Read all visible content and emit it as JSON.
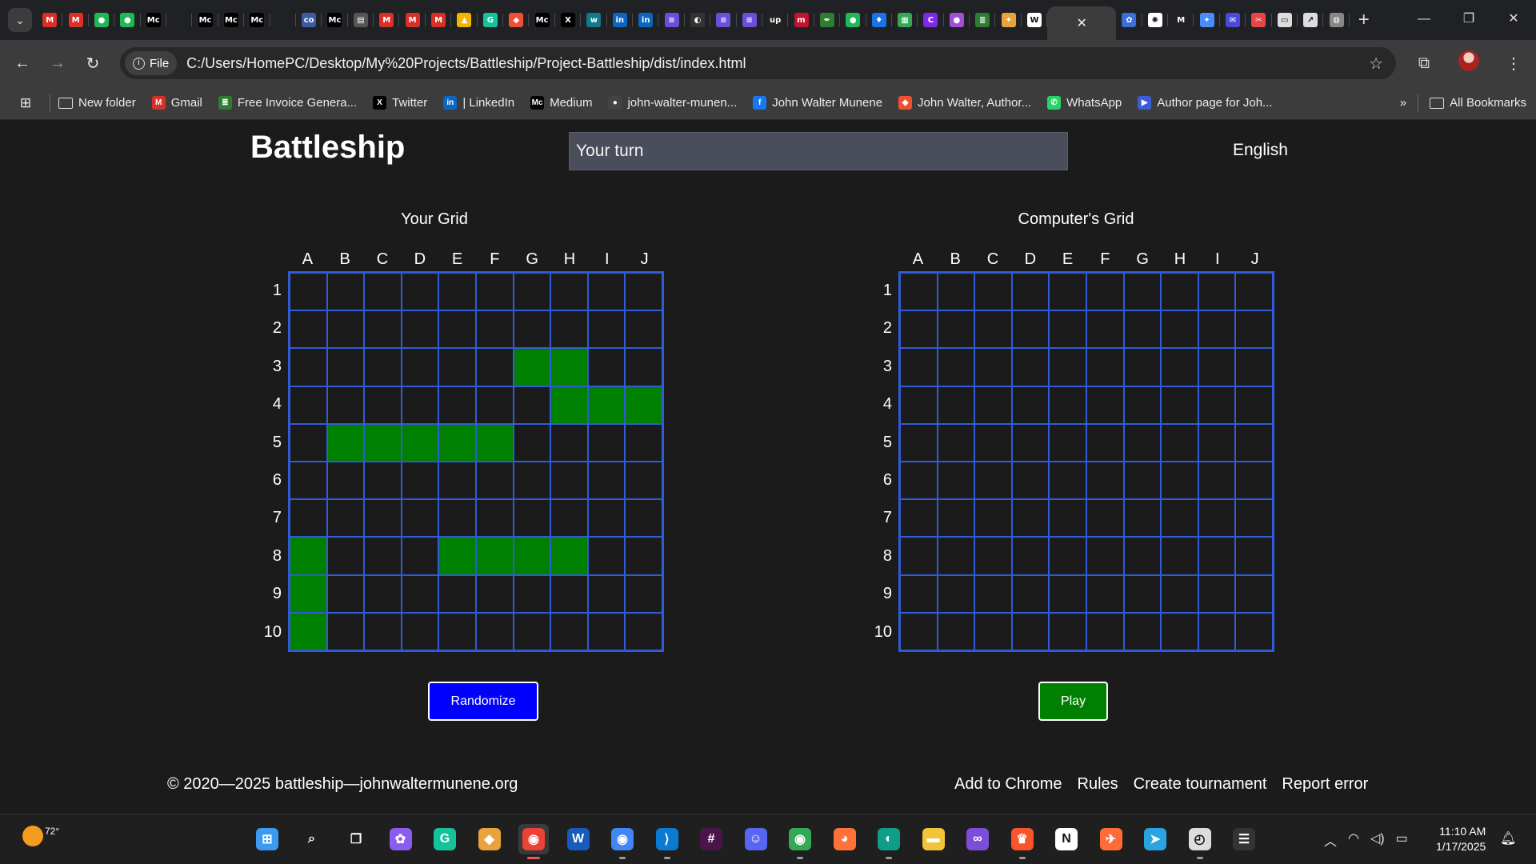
{
  "browser": {
    "tab_favicons": [
      {
        "icon": "gmail-icon",
        "glyph": "M",
        "color": "#d93025"
      },
      {
        "icon": "gmail-icon",
        "glyph": "M",
        "color": "#d93025"
      },
      {
        "icon": "green-dot-icon",
        "glyph": "●",
        "color": "#1db954"
      },
      {
        "icon": "green-dot-icon",
        "glyph": "●",
        "color": "#1db954"
      },
      {
        "icon": "medium-icon",
        "glyph": "Mc",
        "color": "#000000"
      },
      {
        "icon": "blank-icon",
        "glyph": "",
        "color": "#202124"
      },
      {
        "icon": "medium-icon",
        "glyph": "Mc",
        "color": "#000000"
      },
      {
        "icon": "medium-icon",
        "glyph": "Mc",
        "color": "#000000"
      },
      {
        "icon": "medium-icon",
        "glyph": "Mc",
        "color": "#000000"
      },
      {
        "icon": "blank-icon",
        "glyph": "",
        "color": "#202124"
      },
      {
        "icon": "colab-icon",
        "glyph": "co",
        "color": "#3b5ba5"
      },
      {
        "icon": "medium-icon",
        "glyph": "Mc",
        "color": "#000000"
      },
      {
        "icon": "doc-icon",
        "glyph": "▤",
        "color": "#555555"
      },
      {
        "icon": "gmail-icon",
        "glyph": "M",
        "color": "#d93025"
      },
      {
        "icon": "gmail-icon",
        "glyph": "M",
        "color": "#d93025"
      },
      {
        "icon": "gmail-icon",
        "glyph": "M",
        "color": "#d93025"
      },
      {
        "icon": "drive-icon",
        "glyph": "▲",
        "color": "#f4b400"
      },
      {
        "icon": "grammarly-icon",
        "glyph": "G",
        "color": "#15c39a"
      },
      {
        "icon": "git-icon",
        "glyph": "◆",
        "color": "#f05032"
      },
      {
        "icon": "medium-icon",
        "glyph": "Mc",
        "color": "#000000"
      },
      {
        "icon": "x-icon",
        "glyph": "X",
        "color": "#000000"
      },
      {
        "icon": "w-icon",
        "glyph": "w",
        "color": "#0f7a8a"
      },
      {
        "icon": "linkedin-icon",
        "glyph": "in",
        "color": "#0a66c2"
      },
      {
        "icon": "linkedin-icon",
        "glyph": "in",
        "color": "#0a66c2"
      },
      {
        "icon": "list-icon",
        "glyph": "≡",
        "color": "#6b4fd8"
      },
      {
        "icon": "circle-icon",
        "glyph": "◐",
        "color": "#333333"
      },
      {
        "icon": "list-icon",
        "glyph": "≡",
        "color": "#6b4fd8"
      },
      {
        "icon": "list-icon",
        "glyph": "≡",
        "color": "#6b4fd8"
      },
      {
        "icon": "upwork-icon",
        "glyph": "up",
        "color": "#222222"
      },
      {
        "icon": "m-icon",
        "glyph": "m",
        "color": "#c4122f"
      },
      {
        "icon": "pen-icon",
        "glyph": "✒",
        "color": "#2e7d32"
      },
      {
        "icon": "green-dot-icon",
        "glyph": "●",
        "color": "#1db954"
      },
      {
        "icon": "drop-icon",
        "glyph": "♦",
        "color": "#1a73e8"
      },
      {
        "icon": "sheet-icon",
        "glyph": "▦",
        "color": "#34a853"
      },
      {
        "icon": "canva-icon",
        "glyph": "C",
        "color": "#7d2ae8"
      },
      {
        "icon": "avatar-icon",
        "glyph": "●",
        "color": "#a24fd8"
      },
      {
        "icon": "invoice-icon",
        "glyph": "≣",
        "color": "#2e7d32"
      },
      {
        "icon": "fox-icon",
        "glyph": "✦",
        "color": "#e8a33c"
      },
      {
        "icon": "wikipedia-icon",
        "glyph": "W",
        "color": "#ffffff"
      }
    ],
    "tab_favicons_after": [
      {
        "icon": "app-icon",
        "glyph": "✿",
        "color": "#3b6fd8"
      },
      {
        "icon": "chatgpt-icon",
        "glyph": "✺",
        "color": "#ffffff"
      },
      {
        "icon": "medium-icon",
        "glyph": "M",
        "color": "#222222"
      },
      {
        "icon": "gemini-icon",
        "glyph": "✦",
        "color": "#4a8df8"
      },
      {
        "icon": "chat-icon",
        "glyph": "✉",
        "color": "#4a4ad8"
      },
      {
        "icon": "scissors-icon",
        "glyph": "✂",
        "color": "#e84545"
      },
      {
        "icon": "image-icon",
        "glyph": "▭",
        "color": "#dddddd"
      },
      {
        "icon": "chart-icon",
        "glyph": "↗",
        "color": "#dddddd"
      },
      {
        "icon": "globe-icon",
        "glyph": "◍",
        "color": "#888888"
      }
    ],
    "address": {
      "scheme_chip": "File",
      "url": "C:/Users/HomePC/Desktop/My%20Projects/Battleship/Project-Battleship/dist/index.html"
    },
    "bookmarks": [
      {
        "label": "New folder",
        "icon": "folder-icon",
        "color": "#dddddd",
        "glyph": ""
      },
      {
        "label": "Gmail",
        "icon": "gmail-icon",
        "color": "#d93025",
        "glyph": "M"
      },
      {
        "label": "Free Invoice Genera...",
        "icon": "invoice-icon",
        "color": "#2e7d32",
        "glyph": "≣"
      },
      {
        "label": "Twitter",
        "icon": "x-icon",
        "color": "#000000",
        "glyph": "X"
      },
      {
        "label": "| LinkedIn",
        "icon": "linkedin-icon",
        "color": "#0a66c2",
        "glyph": "in"
      },
      {
        "label": "Medium",
        "icon": "medium-icon",
        "color": "#000000",
        "glyph": "Mc"
      },
      {
        "label": "john-walter-munen...",
        "icon": "github-icon",
        "color": "#444444",
        "glyph": "●"
      },
      {
        "label": "John Walter Munene",
        "icon": "facebook-icon",
        "color": "#1877f2",
        "glyph": "f"
      },
      {
        "label": "John Walter, Author...",
        "icon": "git-icon",
        "color": "#f05032",
        "glyph": "◆"
      },
      {
        "label": "WhatsApp",
        "icon": "whatsapp-icon",
        "color": "#25d366",
        "glyph": "✆"
      },
      {
        "label": "Author page for Joh...",
        "icon": "amazon-icon",
        "color": "#3b5bd8",
        "glyph": "▶"
      }
    ],
    "all_bookmarks": "All Bookmarks"
  },
  "game": {
    "title": "Battleship",
    "status": "Your turn",
    "language": "English",
    "columns": [
      "A",
      "B",
      "C",
      "D",
      "E",
      "F",
      "G",
      "H",
      "I",
      "J"
    ],
    "rows": [
      "1",
      "2",
      "3",
      "4",
      "5",
      "6",
      "7",
      "8",
      "9",
      "10"
    ],
    "your_grid_title": "Your Grid",
    "computer_grid_title": "Computer's Grid",
    "ship_color": "#008000",
    "grid_line_color": "#2f5bd8",
    "your_ships": [
      "G3",
      "H3",
      "H4",
      "I4",
      "J4",
      "B5",
      "C5",
      "D5",
      "E5",
      "F5",
      "A8",
      "E8",
      "F8",
      "G8",
      "H8",
      "A9",
      "A10"
    ],
    "computer_ships": [],
    "randomize_label": "Randomize",
    "play_label": "Play",
    "randomize_color": "#0000ff",
    "play_color": "#008000"
  },
  "footer": {
    "copyright": "© 2020—2025 battleship—johnwaltermunene.org",
    "links": [
      "Add to Chrome",
      "Rules",
      "Create tournament",
      "Report error"
    ]
  },
  "taskbar": {
    "temperature": "72°",
    "apps": [
      {
        "name": "windows-start-icon",
        "glyph": "⊞",
        "color": "#3a9bf0",
        "run": false
      },
      {
        "name": "search-icon",
        "glyph": "⌕",
        "color": "transparent",
        "run": false
      },
      {
        "name": "task-view-icon",
        "glyph": "❐",
        "color": "transparent",
        "run": false
      },
      {
        "name": "copilot-icon",
        "glyph": "✿",
        "color": "#8a5cf0",
        "run": false
      },
      {
        "name": "grammarly-icon",
        "glyph": "G",
        "color": "#15c39a",
        "run": false
      },
      {
        "name": "git-kraken-icon",
        "glyph": "◆",
        "color": "#e8a33c",
        "run": false
      },
      {
        "name": "chrome-icon",
        "glyph": "◉",
        "color": "#ea4335",
        "run": true,
        "active": true
      },
      {
        "name": "word-icon",
        "glyph": "W",
        "color": "#185abd",
        "run": false
      },
      {
        "name": "chromium-icon",
        "glyph": "◉",
        "color": "#4285f4",
        "run": true
      },
      {
        "name": "vscode-icon",
        "glyph": "⟩",
        "color": "#0a7bd0",
        "run": true
      },
      {
        "name": "slack-icon",
        "glyph": "#",
        "color": "#4a154b",
        "run": false
      },
      {
        "name": "discord-icon",
        "glyph": "☺",
        "color": "#5865f2",
        "run": false
      },
      {
        "name": "chrome-alt-icon",
        "glyph": "◉",
        "color": "#34a853",
        "run": true
      },
      {
        "name": "firefox-icon",
        "glyph": "◕",
        "color": "#ff7139",
        "run": false
      },
      {
        "name": "edge-icon",
        "glyph": "◐",
        "color": "#0f9d8a",
        "run": true
      },
      {
        "name": "file-explorer-icon",
        "glyph": "▬",
        "color": "#f2c43a",
        "run": false
      },
      {
        "name": "visual-studio-icon",
        "glyph": "∞",
        "color": "#7c4dd8",
        "run": false
      },
      {
        "name": "brave-icon",
        "glyph": "♛",
        "color": "#fb542b",
        "run": true
      },
      {
        "name": "notion-icon",
        "glyph": "N",
        "color": "#ffffff",
        "run": false
      },
      {
        "name": "postman-icon",
        "glyph": "✈",
        "color": "#ff6c37",
        "run": false
      },
      {
        "name": "telegram-icon",
        "glyph": "➤",
        "color": "#2aa3e0",
        "run": false
      },
      {
        "name": "clock-app-icon",
        "glyph": "◴",
        "color": "#dddddd",
        "run": true
      },
      {
        "name": "terminal-icon",
        "glyph": "☰",
        "color": "#333333",
        "run": false
      }
    ],
    "time": "11:10 AM",
    "date": "1/17/2025"
  }
}
